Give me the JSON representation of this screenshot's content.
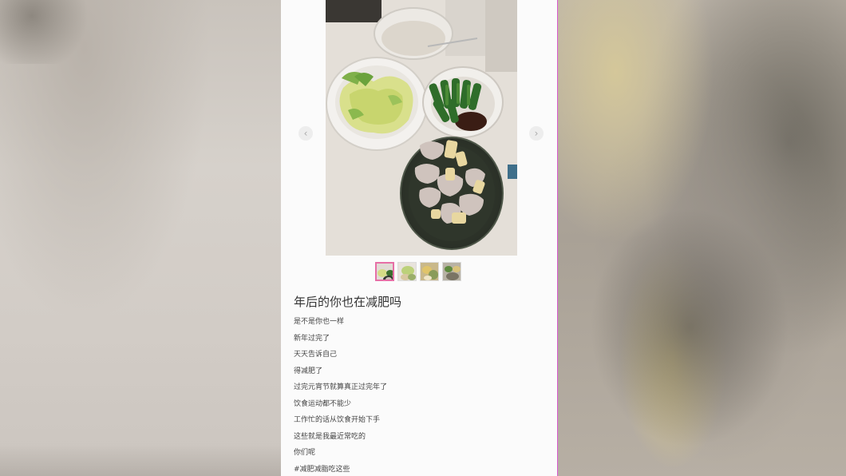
{
  "post": {
    "title": "年后的你也在减肥吗",
    "lines": [
      "是不是你也一样",
      "新年过完了",
      "天天告诉自己",
      "得减肥了",
      "过完元宵节就算真正过完年了",
      "饮食运动都不能少",
      "工作忙的话从饮食开始下手",
      "这些就是我最近常吃的",
      "你们呢",
      "#减肥减脂吃这些"
    ]
  },
  "gallery": {
    "prev_icon": "chevron-left-icon",
    "next_icon": "chevron-right-icon",
    "prev_glyph": "‹",
    "next_glyph": "›",
    "thumbnail_count": 4,
    "active_thumbnail": 1
  },
  "colors": {
    "card_border": "#d85ad0",
    "active_thumb_border": "#e66fa6"
  }
}
